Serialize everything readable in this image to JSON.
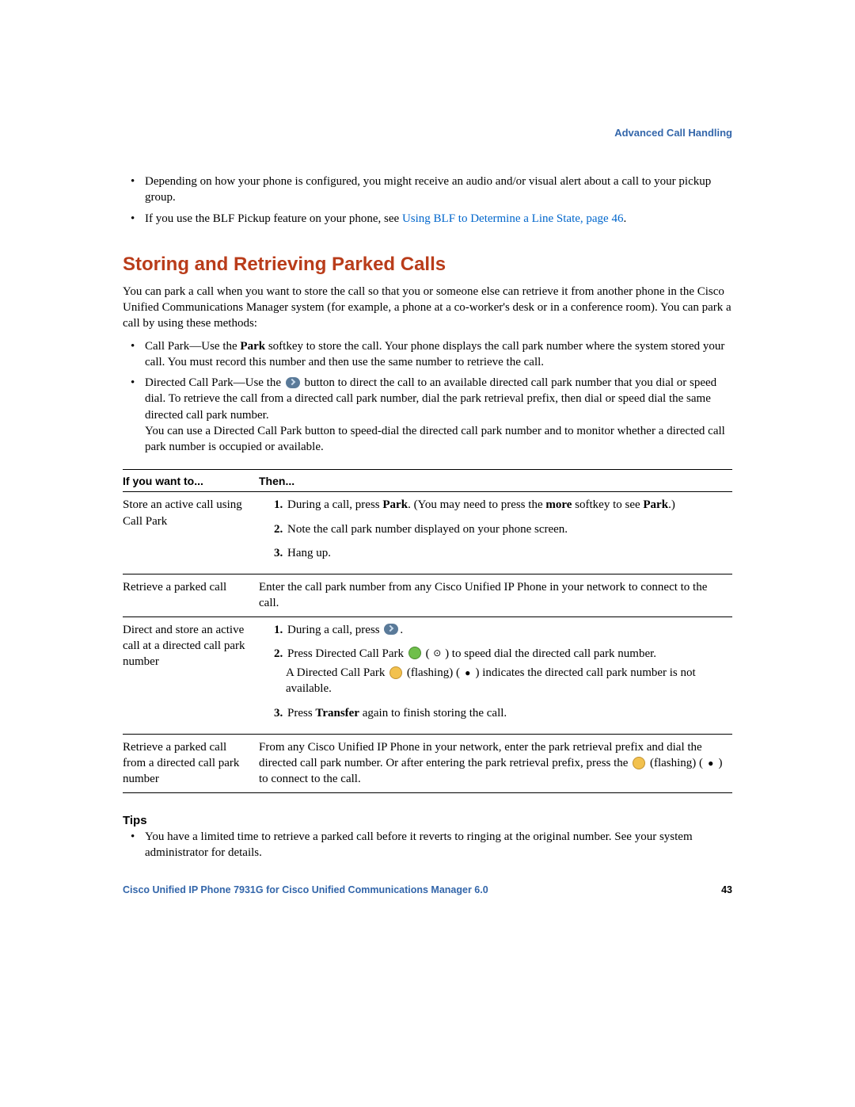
{
  "header": {
    "section_title": "Advanced Call Handling"
  },
  "intro_bullets": {
    "b1": "Depending on how your phone is configured, you might receive an audio and/or visual alert about a call to your pickup group.",
    "b2a": "If you use the BLF Pickup feature on your phone, see ",
    "b2_link": "Using BLF to Determine a Line State, page 46",
    "b2b": "."
  },
  "section": {
    "title": "Storing and Retrieving Parked Calls",
    "p1": "You can park a call when you want to store the call so that you or someone else can retrieve it from another phone in the Cisco Unified Communications Manager system (for example, a phone at a co-worker's desk or in a conference room). You can park a call by using these methods:",
    "m1a": "Call Park—Use the ",
    "m1b": "Park",
    "m1c": " softkey to store the call. Your phone displays the call park number where the system stored your call. You must record this number and then use the same number to retrieve the call.",
    "m2a": "Directed Call Park—Use the ",
    "m2b": " button to direct the call to an available directed call park number that you dial or speed dial. To retrieve the call from a directed call park number, dial the park retrieval prefix, then dial or speed dial the same directed call park number.",
    "m2c": "You can use a Directed Call Park button to speed-dial the directed call park number and to monitor whether a directed call park number is occupied or available."
  },
  "table": {
    "h1": "If you want to...",
    "h2": "Then...",
    "r1c1": "Store an active call using Call Park",
    "r1s1a": "During a call, press ",
    "r1s1b": "Park",
    "r1s1c": ". (You may need to press the ",
    "r1s1d": "more",
    "r1s1e": " softkey to see ",
    "r1s1f": "Park",
    "r1s1g": ".)",
    "r1s2": "Note the call park number displayed on your phone screen.",
    "r1s3": "Hang up.",
    "r2c1": "Retrieve a parked call",
    "r2c2": "Enter the call park number from any Cisco Unified IP Phone in your network to connect to the call.",
    "r3c1": "Direct and store an active call at a directed call park number",
    "r3s1": "During a call, press ",
    "r3s2a": "Press Directed Call Park ",
    "r3s2b": " ( ",
    "r3s2c": " ) to speed dial the directed call park number.",
    "r3ind1a": "A Directed Call Park ",
    "r3ind1b": " (flashing) ( ",
    "r3ind1c": " ) indicates the directed call park number is not available.",
    "r3s3a": "Press ",
    "r3s3b": "Transfer",
    "r3s3c": " again to finish storing the call.",
    "r4c1": "Retrieve a parked call from a directed call park number",
    "r4c2a": "From any Cisco Unified IP Phone in your network, enter the park retrieval prefix and dial the directed call park number. Or after entering the park retrieval prefix, press the ",
    "r4c2b": " (flashing) ( ",
    "r4c2c": " ) to connect to the call."
  },
  "tips": {
    "heading": "Tips",
    "t1": "You have a limited time to retrieve a parked call before it reverts to ringing at the original number. See your system administrator for details."
  },
  "footer": {
    "left": "Cisco Unified IP Phone 7931G for Cisco Unified Communications Manager 6.0",
    "page": "43"
  },
  "glyphs": {
    "ring_open": "⊙",
    "ring_filled": "●"
  }
}
